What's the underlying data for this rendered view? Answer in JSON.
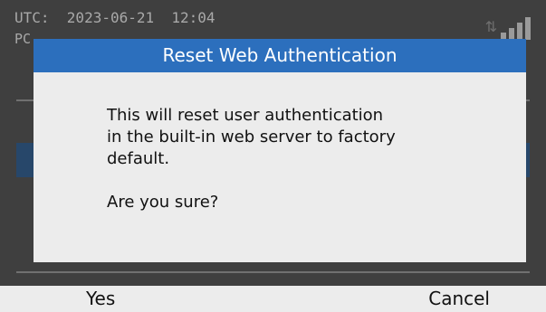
{
  "status": {
    "utc_label": "UTC:",
    "datetime": "2023-06-21  12:04",
    "line2_fragment": "PC",
    "net_icon": "network-activity-icon",
    "signal_icon": "signal-strength-icon"
  },
  "dialog": {
    "title": "Reset Web Authentication",
    "message": "This will reset user authentication\nin the built-in web server to factory\ndefault.",
    "question": "Are you sure?"
  },
  "softkeys": {
    "left_label": "Yes",
    "right_label": "Cancel"
  },
  "colors": {
    "title_bar": "#2c6fbd",
    "dialog_bg": "#ececec",
    "dimmed_bg": "#3f3f3f"
  }
}
